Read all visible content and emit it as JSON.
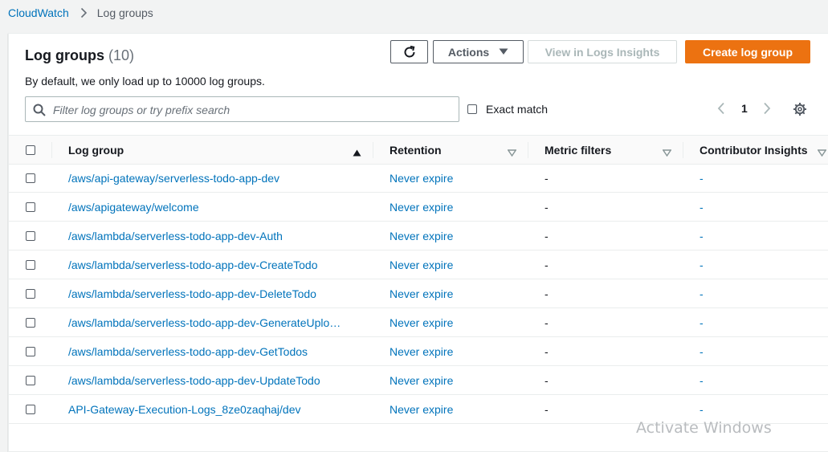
{
  "breadcrumb": {
    "root": "CloudWatch",
    "current": "Log groups"
  },
  "header": {
    "title": "Log groups",
    "count": "(10)",
    "description": "By default, we only load up to 10000 log groups."
  },
  "toolbar": {
    "actions_label": "Actions",
    "insights_label": "View in Logs Insights",
    "create_label": "Create log group"
  },
  "filter": {
    "placeholder": "Filter log groups or try prefix search",
    "exact_match_label": "Exact match"
  },
  "pagination": {
    "current_page": "1"
  },
  "table": {
    "columns": [
      "Log group",
      "Retention",
      "Metric filters",
      "Contributor Insights"
    ],
    "rows": [
      {
        "name": "/aws/api-gateway/serverless-todo-app-dev",
        "retention": "Never expire",
        "metric_filters": "-",
        "contributor_insights": "-"
      },
      {
        "name": "/aws/apigateway/welcome",
        "retention": "Never expire",
        "metric_filters": "-",
        "contributor_insights": "-"
      },
      {
        "name": "/aws/lambda/serverless-todo-app-dev-Auth",
        "retention": "Never expire",
        "metric_filters": "-",
        "contributor_insights": "-"
      },
      {
        "name": "/aws/lambda/serverless-todo-app-dev-CreateTodo",
        "retention": "Never expire",
        "metric_filters": "-",
        "contributor_insights": "-"
      },
      {
        "name": "/aws/lambda/serverless-todo-app-dev-DeleteTodo",
        "retention": "Never expire",
        "metric_filters": "-",
        "contributor_insights": "-"
      },
      {
        "name": "/aws/lambda/serverless-todo-app-dev-GenerateUplo…",
        "retention": "Never expire",
        "metric_filters": "-",
        "contributor_insights": "-"
      },
      {
        "name": "/aws/lambda/serverless-todo-app-dev-GetTodos",
        "retention": "Never expire",
        "metric_filters": "-",
        "contributor_insights": "-"
      },
      {
        "name": "/aws/lambda/serverless-todo-app-dev-UpdateTodo",
        "retention": "Never expire",
        "metric_filters": "-",
        "contributor_insights": "-"
      },
      {
        "name": "API-Gateway-Execution-Logs_8ze0zaqhaj/dev",
        "retention": "Never expire",
        "metric_filters": "-",
        "contributor_insights": "-"
      }
    ]
  },
  "watermark": "Activate Windows",
  "colors": {
    "link": "#0073bb",
    "primary": "#ec7211",
    "background": "#f2f3f3"
  }
}
